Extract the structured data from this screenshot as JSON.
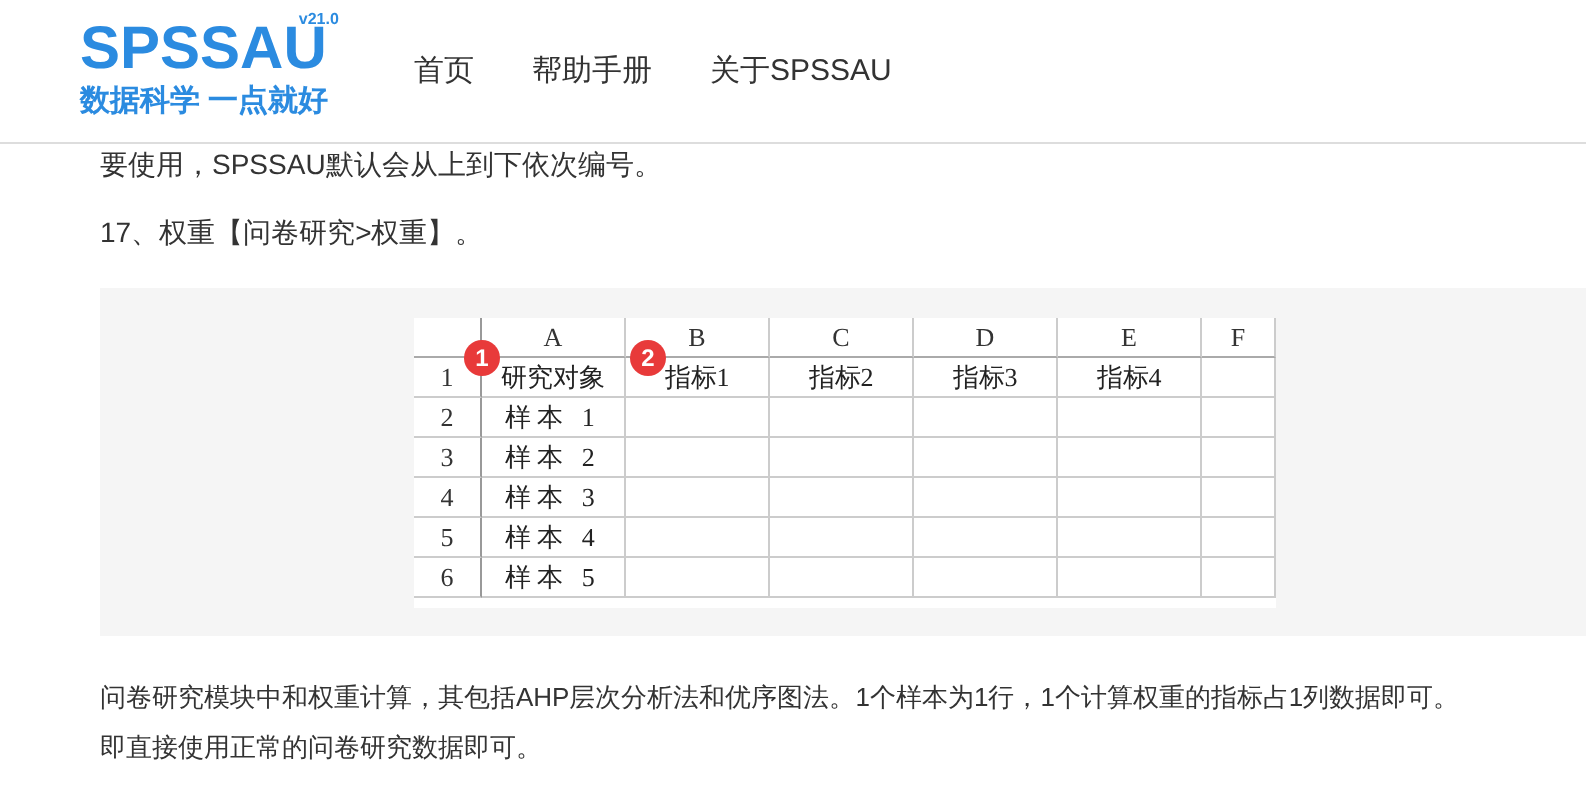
{
  "header": {
    "logo": {
      "name": "SPSSAU",
      "version": "v21.0",
      "slogan": "数据科学 一点就好"
    },
    "nav": [
      {
        "label": "首页"
      },
      {
        "label": "帮助手册"
      },
      {
        "label": "关于SPSSAU"
      }
    ]
  },
  "intro_line": "要使用，SPSSAU默认会从上到下依次编号。",
  "heading": "17、权重【问卷研究>权重】。",
  "sheet": {
    "columns": [
      "A",
      "B",
      "C",
      "D",
      "E",
      "F"
    ],
    "rows": [
      {
        "number": "1",
        "cells": [
          "研究对象",
          "指标1",
          "指标2",
          "指标3",
          "指标4"
        ]
      },
      {
        "number": "2",
        "cells": [
          "样本 1"
        ]
      },
      {
        "number": "3",
        "cells": [
          "样本 2"
        ]
      },
      {
        "number": "4",
        "cells": [
          "样本 3"
        ]
      },
      {
        "number": "5",
        "cells": [
          "样本 4"
        ]
      },
      {
        "number": "6",
        "cells": [
          "样本 5"
        ]
      }
    ],
    "badges": [
      "1",
      "2"
    ]
  },
  "paragraph": [
    "问卷研究模块中和权重计算，其包括AHP层次分析法和优序图法。1个样本为1行，1个计算权重的指标占1列数据即可。",
    "即直接使用正常的问卷研究数据即可。"
  ]
}
